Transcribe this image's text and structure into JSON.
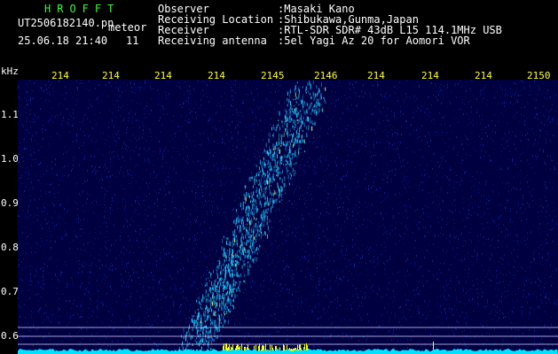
{
  "header": {
    "station": "HROFFT",
    "filename": "UT2506182140.pn",
    "type": "meteor",
    "timestamp": "25.06.18 21:40",
    "count": "11",
    "info": [
      {
        "key": "Observer",
        "value": ":Masaki Kano"
      },
      {
        "key": "Receiving Location",
        "value": ":Shibukawa,Gunma,Japan"
      },
      {
        "key": "Receiver",
        "value": ":RTL-SDR SDR# 43dB L15 114.1MHz USB"
      },
      {
        "key": "Receiving antenna",
        "value": ":5el Yagi Az 20 for Aomori VOR"
      }
    ]
  },
  "spectrogram": {
    "freq_unit": "kHz",
    "time_ticks": [
      "214",
      "214",
      "214",
      "214",
      "2145",
      "2146",
      "214",
      "214",
      "214",
      "2150"
    ],
    "freq_ticks": [
      "1.1",
      "1.0",
      "0.9",
      "0.8",
      "0.7",
      "0.6"
    ],
    "colors": {
      "background": "#000040",
      "noise": "#0a2aa8",
      "signal": "#20c8ff",
      "hot": "#f0ff60",
      "baseline": "#00e0ff",
      "yellow_band": "#ffff00",
      "grid": "#c8c8ff"
    }
  }
}
